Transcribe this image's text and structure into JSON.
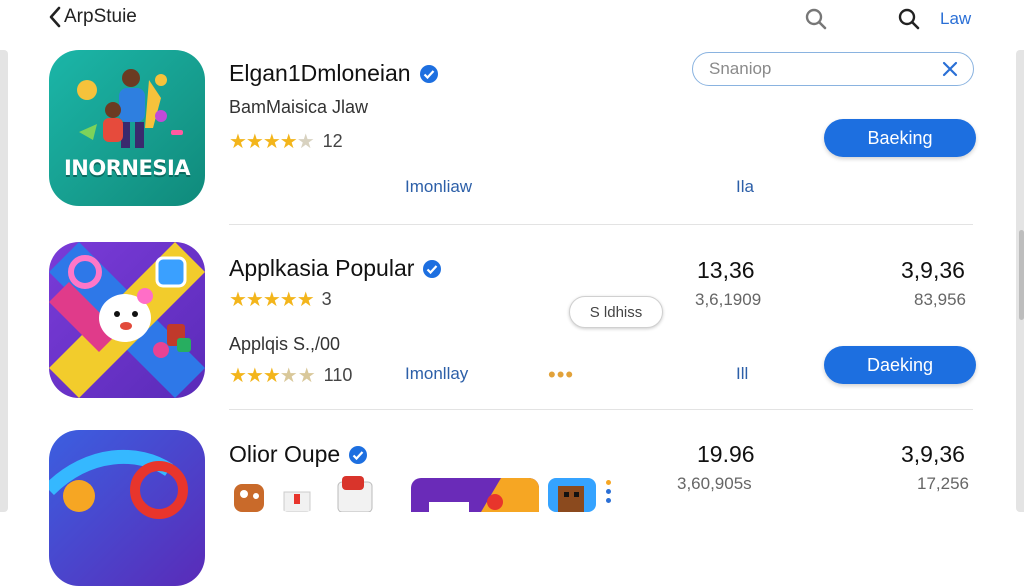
{
  "header": {
    "back_label": "ArpStuie",
    "link_label": "Law"
  },
  "search": {
    "placeholder": "Snaniop"
  },
  "apps": [
    {
      "title": "Elgan1Dmloneian",
      "subtitle": "BamMaisica Jlaw",
      "rating_count": "12",
      "link": "Imonliaw",
      "link2": "Ila",
      "button": "Baeking",
      "icon_text": "INORNESIA"
    },
    {
      "title": "Applkasia Popular",
      "rating_count": "3",
      "subtitle": "Applqis S.,/00",
      "rating_count2": "110",
      "link": "Imonllay",
      "link2": "Ill",
      "button": "Daeking",
      "pill": "S ldhiss",
      "price1": "13,36",
      "price1_sub": "3,6,1909",
      "price2": "3,9,36",
      "price2_sub": "83,956",
      "dots": "•••"
    },
    {
      "title": "Olior Oupe",
      "price1": "19.96",
      "price1_sub": "3,60,905s",
      "price2": "3,9,36",
      "price2_sub": "17,256"
    }
  ],
  "colors": {
    "accent": "#1d6fe0",
    "star": "#f3b51b",
    "link": "#2c5fa8"
  }
}
